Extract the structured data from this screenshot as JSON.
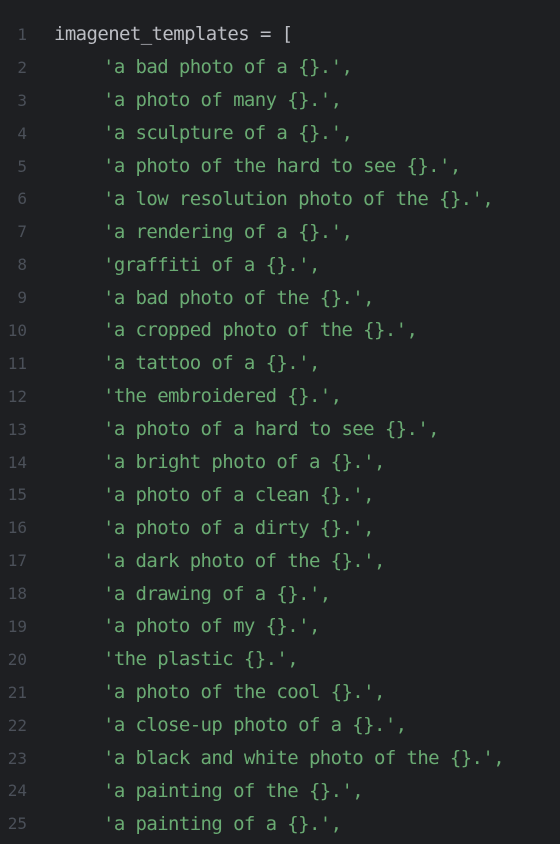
{
  "colors": {
    "background": "#1e1f22",
    "line_number": "#4b5059",
    "identifier": "#bcbec4",
    "string": "#6aab73"
  },
  "code": {
    "first_line": {
      "number": "1",
      "identifier": "imagenet_templates",
      "operator": " = ["
    },
    "lines": [
      {
        "number": "2",
        "text": "'a bad photo of a {}.',"
      },
      {
        "number": "3",
        "text": "'a photo of many {}.',"
      },
      {
        "number": "4",
        "text": "'a sculpture of a {}.',"
      },
      {
        "number": "5",
        "text": "'a photo of the hard to see {}.',"
      },
      {
        "number": "6",
        "text": "'a low resolution photo of the {}.',"
      },
      {
        "number": "7",
        "text": "'a rendering of a {}.',"
      },
      {
        "number": "8",
        "text": "'graffiti of a {}.',"
      },
      {
        "number": "9",
        "text": "'a bad photo of the {}.',"
      },
      {
        "number": "10",
        "text": "'a cropped photo of the {}.',"
      },
      {
        "number": "11",
        "text": "'a tattoo of a {}.',"
      },
      {
        "number": "12",
        "text": "'the embroidered {}.',"
      },
      {
        "number": "13",
        "text": "'a photo of a hard to see {}.',"
      },
      {
        "number": "14",
        "text": "'a bright photo of a {}.',"
      },
      {
        "number": "15",
        "text": "'a photo of a clean {}.',"
      },
      {
        "number": "16",
        "text": "'a photo of a dirty {}.',"
      },
      {
        "number": "17",
        "text": "'a dark photo of the {}.',"
      },
      {
        "number": "18",
        "text": "'a drawing of a {}.',"
      },
      {
        "number": "19",
        "text": "'a photo of my {}.',"
      },
      {
        "number": "20",
        "text": "'the plastic {}.',"
      },
      {
        "number": "21",
        "text": "'a photo of the cool {}.',"
      },
      {
        "number": "22",
        "text": "'a close-up photo of a {}.',"
      },
      {
        "number": "23",
        "text": "'a black and white photo of the {}.',"
      },
      {
        "number": "24",
        "text": "'a painting of the {}.',"
      },
      {
        "number": "25",
        "text": "'a painting of a {}.',"
      }
    ]
  }
}
